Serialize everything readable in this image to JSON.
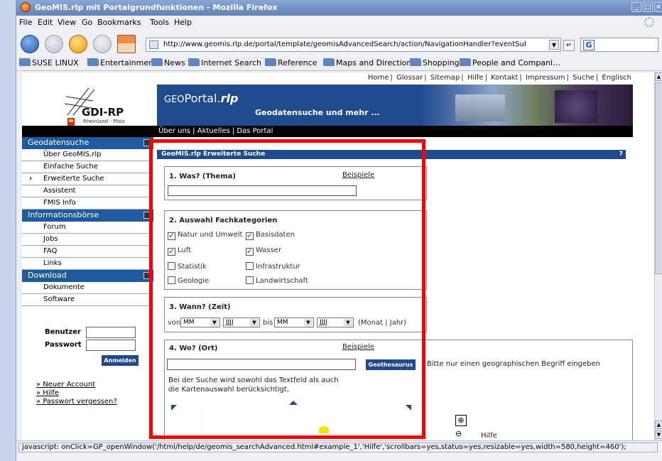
{
  "window": {
    "title": "GeoMIS.rlp mit Portalgrundfunktionen - Mozilla Firefox",
    "menu": [
      "File",
      "Edit",
      "View",
      "Go",
      "Bookmarks",
      "Tools",
      "Help"
    ],
    "url": "http://www.geomis.rlp.de/portal/template/geomisAdvancedSearch/action/NavigationHandler?eventSubmit_doGmadvanc",
    "search_logo": "G"
  },
  "bookmarks": [
    "SUSE LINUX",
    "Entertainment",
    "News",
    "Internet Search",
    "Reference",
    "Maps and Directions",
    "Shopping",
    "People and Compani..."
  ],
  "page": {
    "top_links": [
      "Home",
      "Glossar",
      "Sitemap",
      "Hilfe",
      "Kontakt",
      "Impressum",
      "Suche",
      "Englisch"
    ],
    "logo_text": "GDI-RP",
    "logo_sub": "Rheinland - Pfalz",
    "banner_title": "GEOPortal.rlp",
    "banner_title_a": "GEO",
    "banner_title_b": "Portal.",
    "banner_title_c": "rlp",
    "banner_sub": "Geodatensuche und mehr ...",
    "black_links": "Über uns  |  Aktuelles  |  Das Portal",
    "sidebar": {
      "sections": [
        {
          "title": "Geodatensuche",
          "items": [
            "Über GeoMIS.rlp",
            "Einfache Suche",
            "Erweiterte Suche",
            "Assistent",
            "FMIS Info"
          ]
        },
        {
          "title": "Informationsbörse",
          "items": [
            "Forum",
            "Jobs",
            "FAQ",
            "Links"
          ]
        },
        {
          "title": "Download",
          "items": [
            "Dokumente",
            "Software"
          ]
        }
      ],
      "active_marker": "›"
    },
    "login": {
      "user_label": "Benutzer",
      "pass_label": "Passwort",
      "button": "Anmelden",
      "links": [
        "» Neuer Account",
        "» Hilfe",
        "» Passwort vergessen?"
      ]
    },
    "form": {
      "header": "GeoMIS.rlp Erweiterte Suche",
      "help": "?",
      "s1": {
        "title": "1. Was? (Thema)",
        "examples": "Beispiele"
      },
      "s2": {
        "title": "2. Auswahl Fachkategorien",
        "categories": [
          {
            "label": "Natur und Umwelt",
            "checked": true
          },
          {
            "label": "Basisdaten",
            "checked": true
          },
          {
            "label": "Luft",
            "checked": true
          },
          {
            "label": "Wasser",
            "checked": true
          },
          {
            "label": "Statistik",
            "checked": false
          },
          {
            "label": "Infrastruktur",
            "checked": false
          },
          {
            "label": "Geologie",
            "checked": false
          },
          {
            "label": "Landwirtschaft",
            "checked": false
          }
        ]
      },
      "s3": {
        "title": "3. Wann? (Zeit)",
        "von": "von",
        "bis": "bis",
        "mm": "MM",
        "jjjj": "JJJJ",
        "suffix": "(Monat | Jahr)"
      },
      "s4": {
        "title": "4. Wo? (Ort)",
        "examples": "Beispiele",
        "button": "Geothesaurus",
        "hint": "Bitte nur einen geographischen Begriff eingeben",
        "note": "Bei der Suche wird sowohl das Textfeld als auch die Kartenauswahl berücksichtigt.",
        "help": "Hilfe"
      }
    }
  },
  "status": "javascript: onClick=GP_openWindow('/html/help/de/geomis_searchAdvanced.html#example_1','Hilfe','scrollbars=yes,status=yes,resizable=yes,width=580,height=460');",
  "colors": {
    "header_blue": "#1f4a8c",
    "sidebar_blue": "#1f5a9e",
    "highlight": "#ff0000"
  }
}
